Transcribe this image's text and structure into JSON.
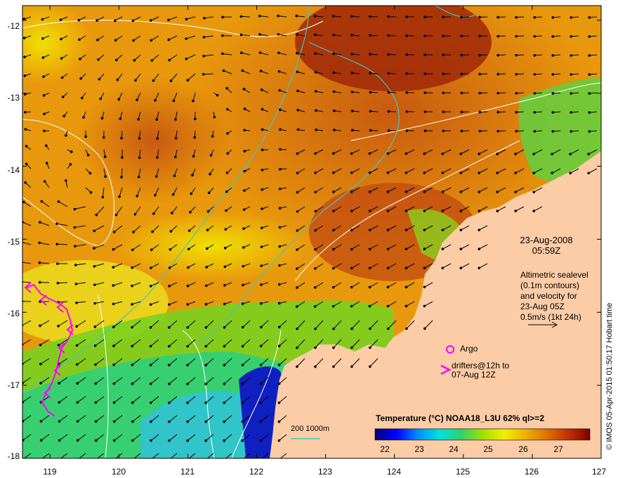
{
  "map": {
    "lon_range": [
      118.6,
      127
    ],
    "lat_range": [
      -18,
      -11.8
    ],
    "lon_ticks": [
      "119",
      "120",
      "121",
      "122",
      "123",
      "124",
      "125",
      "126",
      "127"
    ],
    "lat_ticks": [
      "-12",
      "-13",
      "-14",
      "-15",
      "-16",
      "-17",
      "-18"
    ],
    "colors": {
      "land": "#fbcca6",
      "coast_contour": "#40c8c0",
      "sealevel_contour": "#ffffff",
      "drifter": "#ff00ff",
      "arrow": "#000000"
    }
  },
  "annotation": {
    "date": "23-Aug-2008",
    "time": "05:59Z",
    "alt_lines": [
      "Altimetric sealevel",
      "(0.1m contours)",
      "and velocity for",
      "23-Aug 05Z",
      "0.5m/s (1kt 24h)"
    ],
    "argo_label": "Argo",
    "drifters_line1": "drifters@12h to",
    "drifters_line2": "07-Aug 12Z",
    "scale_label": "200  1000m"
  },
  "colorbar": {
    "title": "Temperature (°C) NOAA18_L3U 62% ql>=2",
    "range": [
      21.5,
      27.8
    ],
    "ticks": [
      "22",
      "23",
      "24",
      "25",
      "26",
      "27"
    ],
    "stops": [
      "#000080",
      "#0000ff",
      "#0090ff",
      "#00e0e0",
      "#30d070",
      "#a0e000",
      "#f0f000",
      "#f0b000",
      "#e07000",
      "#c03000",
      "#800000"
    ]
  },
  "credit": "© IMOS 05-Apr-2015 01:50:17 Hobart time"
}
